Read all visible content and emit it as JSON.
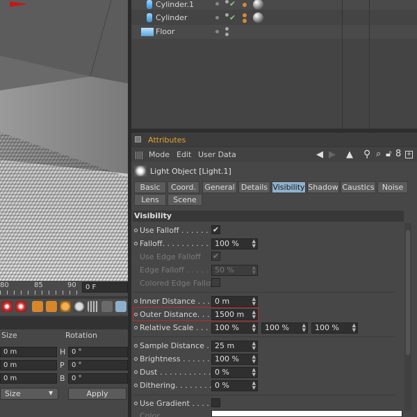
{
  "object_manager": {
    "rows": [
      {
        "name": "Cylinder.1"
      },
      {
        "name": "Cylinder"
      },
      {
        "name": "Floor"
      }
    ]
  },
  "attributes": {
    "title": "Attributes",
    "menu": [
      "Mode",
      "Edit",
      "User Data"
    ],
    "object_title": "Light Object [Light.1]",
    "tabs_row1": [
      "Basic",
      "Coord.",
      "General",
      "Details",
      "Visibility",
      "Shadow",
      "Caustics",
      "Noise"
    ],
    "tabs_row2": [
      "Lens",
      "Scene"
    ],
    "active_tab": "Visibility",
    "section": "Visibility",
    "params": {
      "use_falloff": "Use Falloff . . . . . . .",
      "falloff": "Falloff. . . . . . . . . . .",
      "falloff_value": "100 %",
      "use_edge_falloff": "Use Edge Falloff",
      "edge_falloff": "Edge Falloff . . . . .",
      "edge_falloff_value": "50 %",
      "colored_edge_falloff": "Colored Edge Falloff",
      "inner_distance": "Inner Distance . . . .",
      "inner_distance_value": "0 m",
      "outer_distance": "Outer Distance. . . .",
      "outer_distance_value": "1500 m",
      "relative_scale": "Relative Scale . . . .",
      "relative_scale_x": "100 %",
      "relative_scale_y": "100 %",
      "relative_scale_z": "100 %",
      "sample_distance": "Sample Distance . . .",
      "sample_distance_value": "25 m",
      "brightness": "Brightness . . . . . . .",
      "brightness_value": "100 %",
      "dust": "Dust . . . . . . . . . . .",
      "dust_value": "0 %",
      "dithering": "Dithering. . . . . . . . .",
      "dithering_value": "0 %",
      "use_gradient": "Use Gradient . . . . .",
      "color": "Color"
    },
    "highlight_color": "#c0282a"
  },
  "timeline": {
    "ticks": [
      "80",
      "85",
      "90"
    ],
    "current_frame": "0 F"
  },
  "coordinates": {
    "size_header": "Size",
    "rotation_header": "Rotation",
    "size_values": [
      "0 m",
      "0 m",
      "0 m"
    ],
    "rotation_labels": [
      "H",
      "P",
      "B"
    ],
    "rotation_values": [
      "0 °",
      "0 °",
      "0 °"
    ],
    "mode_select": "Size",
    "apply_label": "Apply"
  }
}
